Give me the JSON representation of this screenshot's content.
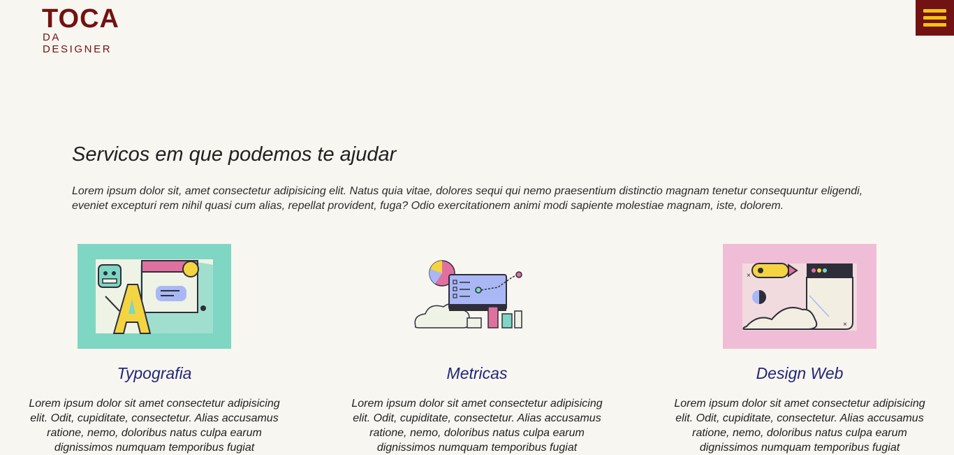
{
  "header": {
    "logo_main": "TOCA",
    "logo_sub": "DA DESIGNER",
    "menu_icon": "hamburger-icon",
    "accent": "#731212",
    "menu_line_color": "#f1c40f"
  },
  "services": {
    "title": "Servicos em que podemos te ajudar",
    "intro": "Lorem ipsum dolor sit, amet consectetur adipisicing elit. Natus quia vitae, dolores sequi qui nemo praesentium distinctio magnam tenetur consequuntur eligendi, eveniet excepturi rem nihil quasi cum alias, repellat provident, fuga? Odio exercitationem animi modi sapiente molestiae magnam, iste, dolorem.",
    "cards": [
      {
        "title": "Typografia",
        "text": "Lorem ipsum dolor sit amet consectetur adipisicing elit. Odit, cupiditate, consectetur. Alias accusamus ratione, nemo, doloribus natus culpa earum dignissimos numquam temporibus fugiat",
        "illustration": "typography-illustration",
        "bg": "#7fd6c2"
      },
      {
        "title": "Metricas",
        "text": "Lorem ipsum dolor sit amet consectetur adipisicing elit. Odit, cupiditate, consectetur. Alias accusamus ratione, nemo, doloribus natus culpa earum dignissimos numquam temporibus fugiat",
        "illustration": "metrics-illustration",
        "bg": "#f8f6f0"
      },
      {
        "title": "Design Web",
        "text": "Lorem ipsum dolor sit amet consectetur adipisicing elit. Odit, cupiditate, consectetur. Alias accusamus ratione, nemo, doloribus natus culpa earum dignissimos numquam temporibus fugiat",
        "illustration": "web-design-illustration",
        "bg": "#efbdd6"
      }
    ]
  }
}
